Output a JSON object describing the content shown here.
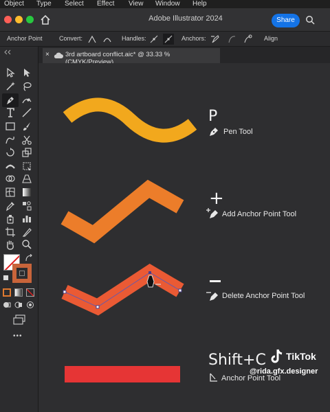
{
  "menubar": {
    "items": [
      "Object",
      "Type",
      "Select",
      "Effect",
      "View",
      "Window",
      "Help"
    ]
  },
  "window": {
    "title": "Adobe Illustrator 2024",
    "share_label": "Share"
  },
  "control_bar": {
    "tool_name": "Anchor Point",
    "convert_label": "Convert:",
    "handles_label": "Handles:",
    "anchors_label": "Anchors:",
    "align_label": "Align"
  },
  "document_tab": {
    "title": "3rd artboard conflict.aic* @ 33.33 % (CMYK/Preview)",
    "close": "×"
  },
  "toolbar": {
    "more": "•••",
    "fill_color": "#c8643a",
    "stroke_color": "#2a2a3a"
  },
  "tools_demo": [
    {
      "hotkey": "P",
      "name": "Pen Tool",
      "color": "#f2a81d"
    },
    {
      "hotkey": "+",
      "name": "Add Anchor Point Tool",
      "color": "#ec7d2a"
    },
    {
      "hotkey": "-",
      "name": "Delete Anchor Point Tool",
      "color": "#ea5a34"
    },
    {
      "hotkey": "Shift+C",
      "name": "Anchor Point Tool",
      "color": "#e63535"
    }
  ],
  "watermark": {
    "brand": "TikTok",
    "handle": "@rida.gfx.designer"
  }
}
